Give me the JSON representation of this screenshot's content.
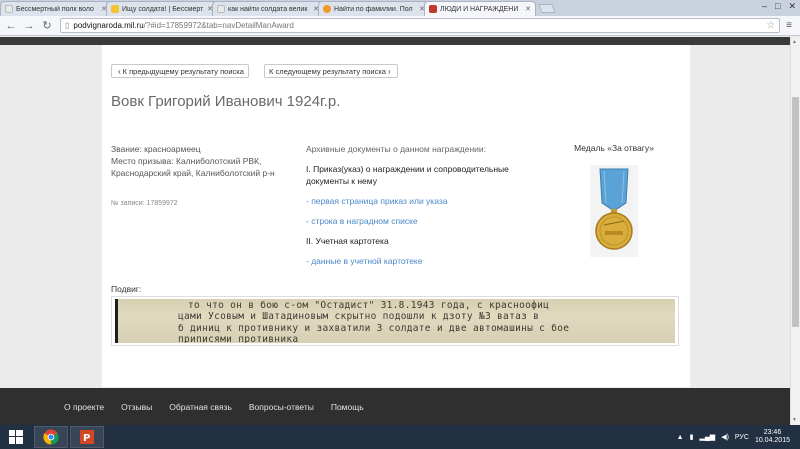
{
  "browser": {
    "tabs": [
      {
        "label": "Бессмертный полк воло",
        "favicon_color": "#e8e8e8",
        "active": false
      },
      {
        "label": "Ищу солдата! | Бессмерт",
        "favicon_color": "#f3c330",
        "active": false
      },
      {
        "label": "как найти солдата велик",
        "favicon_color": "#e8e8e8",
        "active": false
      },
      {
        "label": "Найти по фамилии. Пол",
        "favicon_color": "#f09a2c",
        "active": false
      },
      {
        "label": "ЛЮДИ И НАГРАЖДЕНИ",
        "favicon_color": "#c0392b",
        "active": true
      }
    ],
    "url_host": "podvignaroda.mil.ru",
    "url_path": "/?#id=17859972&tab=navDetailManAward"
  },
  "pager": {
    "prev": "К предыдущему результату поиска",
    "next": "К следующему результату поиска"
  },
  "person": {
    "name": "Вовк Григорий Иванович 1924г.р.",
    "rank": "Звание: красноармеец",
    "draft": "Место призыва: Калниболотский РВК, Краснодарский край, Калниболотский р-н",
    "record_no": "№ записи: 17859972"
  },
  "archive": {
    "heading": "Архивные документы о данном награждении:",
    "section1": "I. Приказ(указ) о награждении и сопроводительные документы к нему",
    "link1": "- первая страница приказ или указа",
    "link2": "- строка в наградном списке",
    "section2": "II. Учетная картотека",
    "link3": "- данные в учетной картотеке"
  },
  "award": {
    "title": "Медаль «За отвагу»",
    "ribbon_color": "#5aa3d6",
    "medal_color": "#d9ad3c"
  },
  "feat": {
    "label": "Подвиг:",
    "lines": [
      "то что он в бою с-ом \"Остадист\" 31.8.1943 года, с красноофиц",
      "цами Усовым и Шатадиновым скрытно подошли к дзоту №3 ватаз в",
      "б диниц к противнику и захватили 3 солдате и две автомашины с бое",
      "приписями противника"
    ]
  },
  "footer": {
    "links": [
      "О проекте",
      "Отзывы",
      "Обратная связь",
      "Вопросы-ответы",
      "Помощь"
    ]
  },
  "taskbar": {
    "lang": "РУС",
    "time": "23:46",
    "date": "10.04.2015"
  }
}
